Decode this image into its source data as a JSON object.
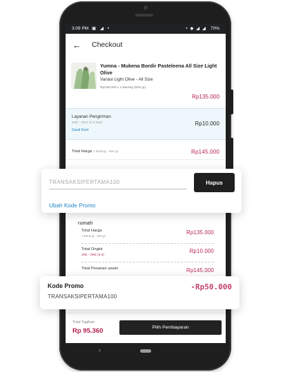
{
  "status_bar": {
    "time": "3:09 PM",
    "left_icons": "▣ ◢ •",
    "right_icons": "• ◆ ◢ ◢",
    "battery": "70%"
  },
  "header": {
    "title": "Checkout"
  },
  "product": {
    "name": "Yumna - Mukena Bordir Pasteleena  All Size Light Olive",
    "variant": "Variasi Light Olive - All Size",
    "meta": "Rp135.000 x 1 Barang (500 gr)",
    "price": "Rp135.000"
  },
  "shipping": {
    "title": "Layanan Pengiriman",
    "service": "JNE - OKE (2-3 hari)",
    "change_label": "Ganti Kurir",
    "price": "Rp10.000"
  },
  "total": {
    "label": "Total Harga",
    "sub": "1 barang - 500 gr",
    "value": "Rp145.000"
  },
  "promo": {
    "placeholder": "TRANSAKSIPERTAMA100",
    "remove_label": "Hapus",
    "change_link": "Ubah Kode Promo"
  },
  "summary": {
    "heading": "rumah",
    "rows": [
      {
        "label": "Total Harga",
        "sub": "1 Barang - 500 gr",
        "value": "Rp135.000"
      },
      {
        "label": "Total Ongkir",
        "sub": "JNE - OKE (2-3)",
        "value": "Rp10.000"
      },
      {
        "label": "Total Pesanan aswin",
        "sub": "",
        "value": "Rp145.000"
      }
    ]
  },
  "promo_applied": {
    "title": "Kode Promo",
    "code": "TRANSAKSIPERTAMA100",
    "value": "-Rp50.000"
  },
  "bottom_bar": {
    "total_label": "Total Tagihan",
    "total_value": "Rp 95.360",
    "pay_label": "Pilih Pembayaran"
  }
}
